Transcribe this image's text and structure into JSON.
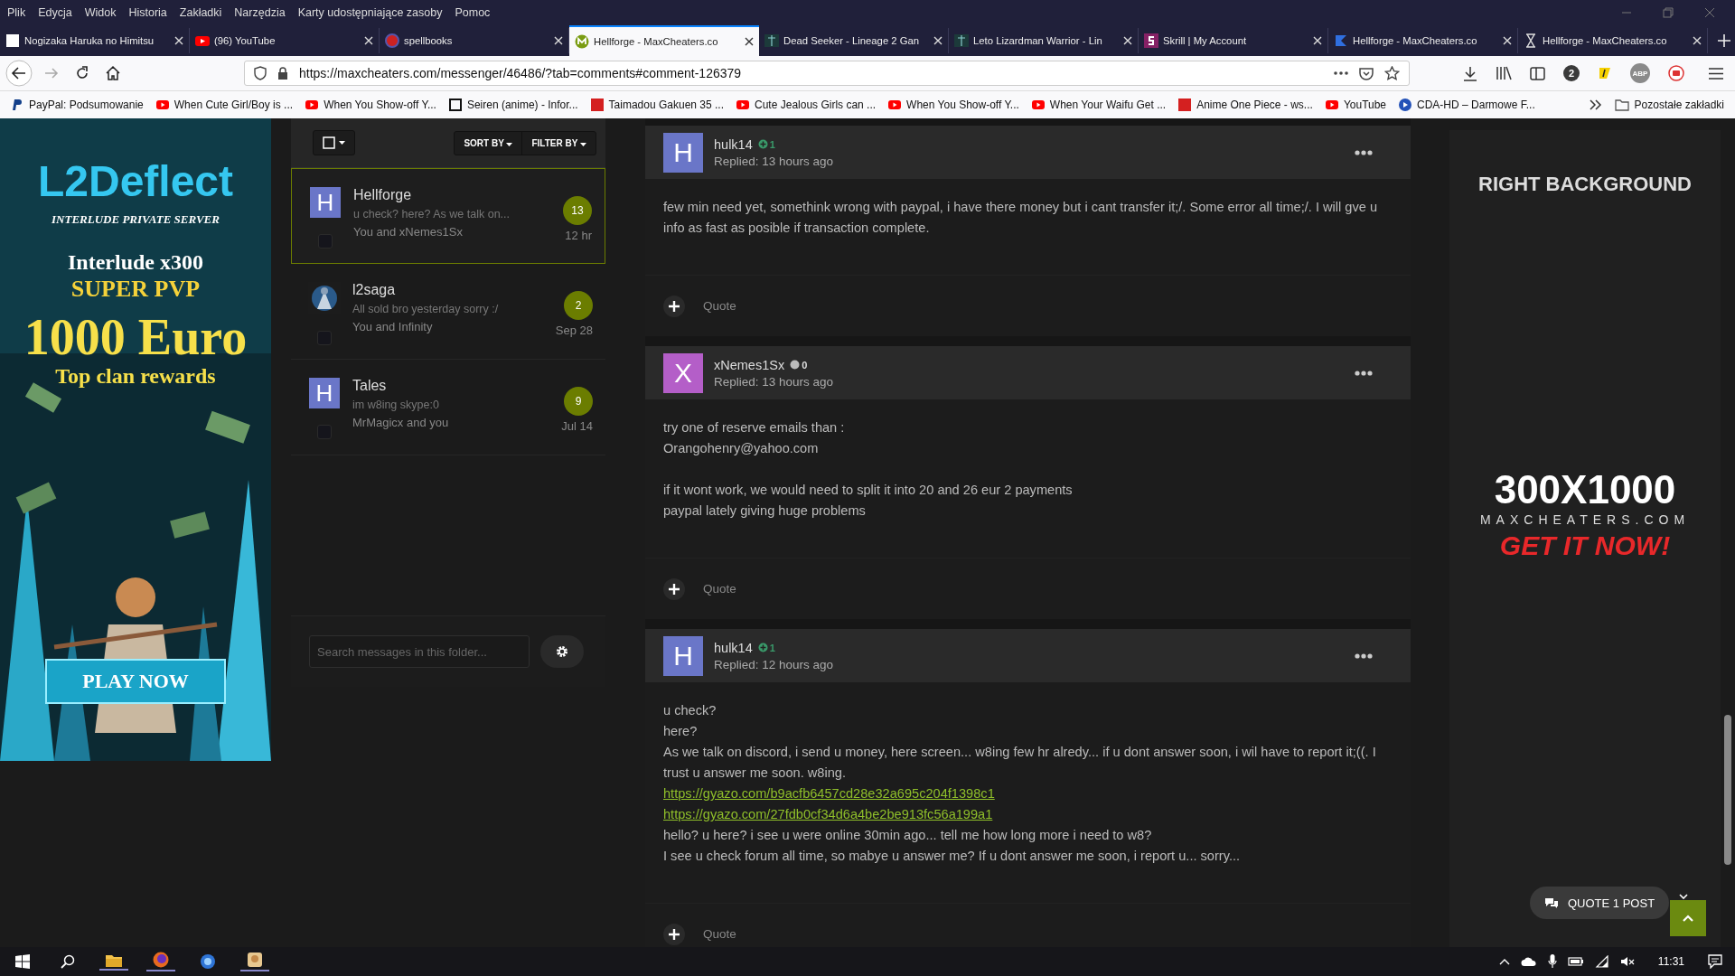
{
  "menu_bar": {
    "items": [
      "Plik",
      "Edycja",
      "Widok",
      "Historia",
      "Zakładki",
      "Narzędzia",
      "Karty udostępniające zasoby",
      "Pomoc"
    ]
  },
  "tabs": [
    {
      "title": "Nogizaka Haruka no Himitsu",
      "kind": "letter",
      "selected": false
    },
    {
      "title": "(96) YouTube",
      "kind": "youtube",
      "selected": false
    },
    {
      "title": "spellbooks",
      "kind": "badge",
      "selected": false
    },
    {
      "title": "Hellforge - MaxCheaters.co",
      "kind": "maxcheaters",
      "selected": true
    },
    {
      "title": "Dead Seeker - Lineage 2 Gan",
      "kind": "lineage",
      "selected": false
    },
    {
      "title": "Leto Lizardman Warrior - Lin",
      "kind": "lineage",
      "selected": false
    },
    {
      "title": "Skrill | My Account",
      "kind": "skrill",
      "selected": false
    },
    {
      "title": "Hellforge - MaxCheaters.co",
      "kind": "flag",
      "selected": false
    },
    {
      "title": "Hellforge - MaxCheaters.co",
      "kind": "hourglass",
      "selected": false
    }
  ],
  "address_bar": {
    "url": "https://maxcheaters.com/messenger/46486/?tab=comments#comment-126379"
  },
  "toolbar": {
    "account_badge": "2",
    "adblock_label": "ABP"
  },
  "bookmarks": [
    {
      "label": "PayPal: Podsumowanie",
      "kind": "paypal"
    },
    {
      "label": "When Cute Girl/Boy is ...",
      "kind": "youtube"
    },
    {
      "label": "When You Show-off Y...",
      "kind": "youtube"
    },
    {
      "label": "Seiren (anime) - Infor...",
      "kind": "square"
    },
    {
      "label": "Taimadou Gakuen 35 ...",
      "kind": "cda"
    },
    {
      "label": "Cute Jealous Girls can ...",
      "kind": "youtube"
    },
    {
      "label": "When You Show-off Y...",
      "kind": "youtube"
    },
    {
      "label": "When Your Waifu Get ...",
      "kind": "youtube"
    },
    {
      "label": "Anime One Piece - ws...",
      "kind": "cda"
    },
    {
      "label": "YouTube",
      "kind": "youtube"
    },
    {
      "label": "CDA-HD – Darmowe F...",
      "kind": "play"
    }
  ],
  "bookmarks_folder": "Pozostałe zakładki",
  "left_ad": {
    "logo": "L2Deflect",
    "subtitle": "INTERLUDE PRIVATE SERVER",
    "rate": "Interlude x300",
    "mode": "SUPER PVP",
    "prize": "1000 Euro",
    "prize_note": "Top clan rewards",
    "button": "PLAY NOW"
  },
  "messenger": {
    "sort_label": "SORT BY",
    "filter_label": "FILTER BY",
    "conversations": [
      {
        "name": "Hellforge",
        "kind": "letter",
        "avatar_letter": "H",
        "preview": "u check? here? As we talk on...",
        "participants": "You and xNemes1Sx",
        "count": "13",
        "time": "12 hr",
        "selected": true,
        "checked": false
      },
      {
        "name": "l2saga",
        "kind": "picture",
        "preview": "All sold bro yesterday sorry :/",
        "participants": "You and Infinity",
        "count": "2",
        "time": "Sep 28",
        "selected": false,
        "checked": false
      },
      {
        "name": "Tales",
        "kind": "letter",
        "avatar_letter": "H",
        "preview": "im w8ing skype:0",
        "participants": "MrMagicx and you",
        "count": "9",
        "time": "Jul 14",
        "selected": false,
        "checked": false
      }
    ],
    "search": {
      "placeholder": "Search messages in this folder..."
    }
  },
  "posts": [
    {
      "author": "hulk14",
      "avatar_letter": "H",
      "color": "#6a76c8",
      "reputation": {
        "kind": "positive",
        "value": "1"
      },
      "replied": "Replied: 13 hours ago",
      "quote": "Quote",
      "body": [
        {
          "kind": "text",
          "text": "few min need yet, somethink wrong with paypal, i have there money but i cant transfer it;/. Some error all time;/. I will gve u info as fast as posible if transaction complete."
        }
      ]
    },
    {
      "author": "xNemes1Sx",
      "avatar_letter": "X",
      "color": "#b45ec8",
      "reputation": {
        "kind": "neutral",
        "value": "0"
      },
      "replied": "Replied: 13 hours ago",
      "quote": "Quote",
      "body": [
        {
          "kind": "text",
          "text": "try one of reserve emails than :"
        },
        {
          "kind": "text",
          "text": "Orangohenry@yahoo.com"
        },
        {
          "kind": "gap"
        },
        {
          "kind": "text",
          "text": "if it wont work, we would need to split it into 20 and 26 eur 2 payments"
        },
        {
          "kind": "text",
          "text": "paypal lately giving huge problems"
        }
      ]
    },
    {
      "author": "hulk14",
      "avatar_letter": "H",
      "color": "#6a76c8",
      "reputation": {
        "kind": "positive",
        "value": "1"
      },
      "replied": "Replied: 12 hours ago",
      "quote": "Quote",
      "body": [
        {
          "kind": "text",
          "text": "u check?"
        },
        {
          "kind": "text",
          "text": "here?"
        },
        {
          "kind": "text",
          "text": "As we talk on discord, i send u money, here screen... w8ing few hr alredy... if u dont answer soon, i wil have to report it;((. I trust u answer me soon. w8ing."
        },
        {
          "kind": "link",
          "text": "https://gyazo.com/b9acfb6457cd28e32a695c204f1398c1"
        },
        {
          "kind": "link",
          "text": "https://gyazo.com/27fdb0cf34d6a4be2be913fc56a199a1"
        },
        {
          "kind": "text",
          "text": "hello? u here? i see u were online 30min ago... tell me how long more i need to w8?"
        },
        {
          "kind": "text",
          "text": "I see u check forum all time, so mabye u answer me? If u dont answer me soon, i report u... sorry..."
        }
      ]
    }
  ],
  "right_ad": {
    "heading": "RIGHT BACKGROUND",
    "size": "300X1000",
    "site": "MAXCHEATERS.COM",
    "cta": "GET IT NOW!"
  },
  "quote_button": "QUOTE 1 POST",
  "taskbar": {
    "time": "11:31"
  }
}
